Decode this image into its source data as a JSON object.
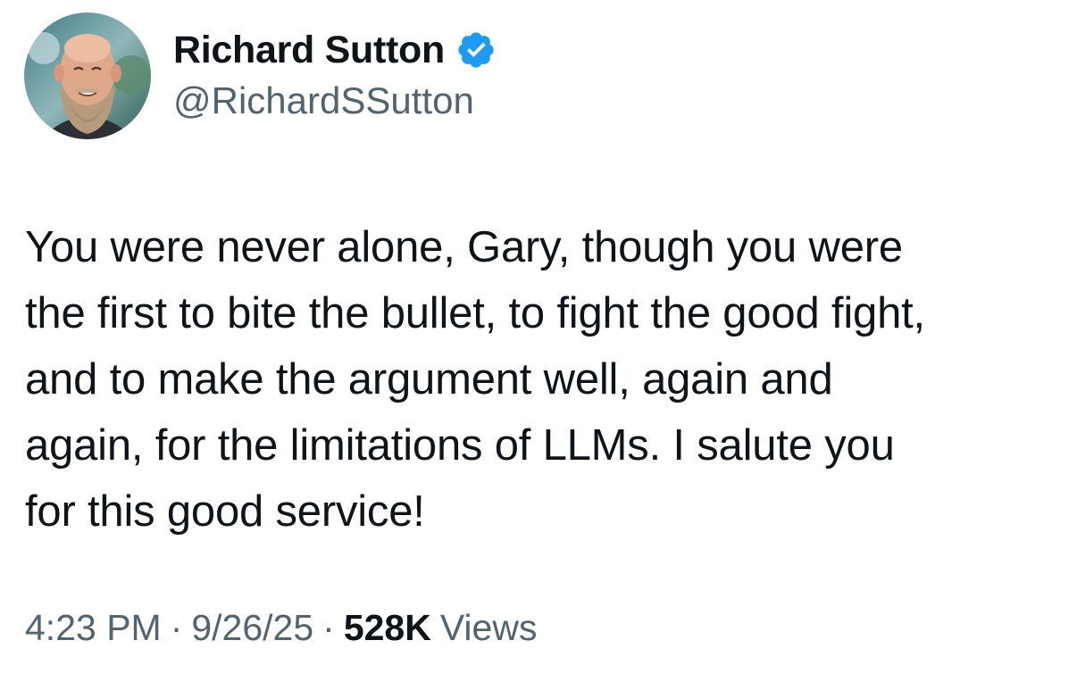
{
  "author": {
    "display_name": "Richard Sutton",
    "handle": "@RichardSSutton",
    "verified_icon": "verified-badge-icon",
    "verified_color": "#1d9bf0"
  },
  "tweet": {
    "text": "You were never alone, Gary, though you were\nthe first to bite the bullet, to fight the good fight,\nand to make the argument well, again and\nagain, for the limitations of LLMs. I salute you\nfor this good service!",
    "time": "4:23 PM",
    "separator": "·",
    "date": "9/26/25",
    "views_count": "528K",
    "views_label": "Views"
  },
  "colors": {
    "text_primary": "#0f1419",
    "text_secondary": "#536471"
  }
}
